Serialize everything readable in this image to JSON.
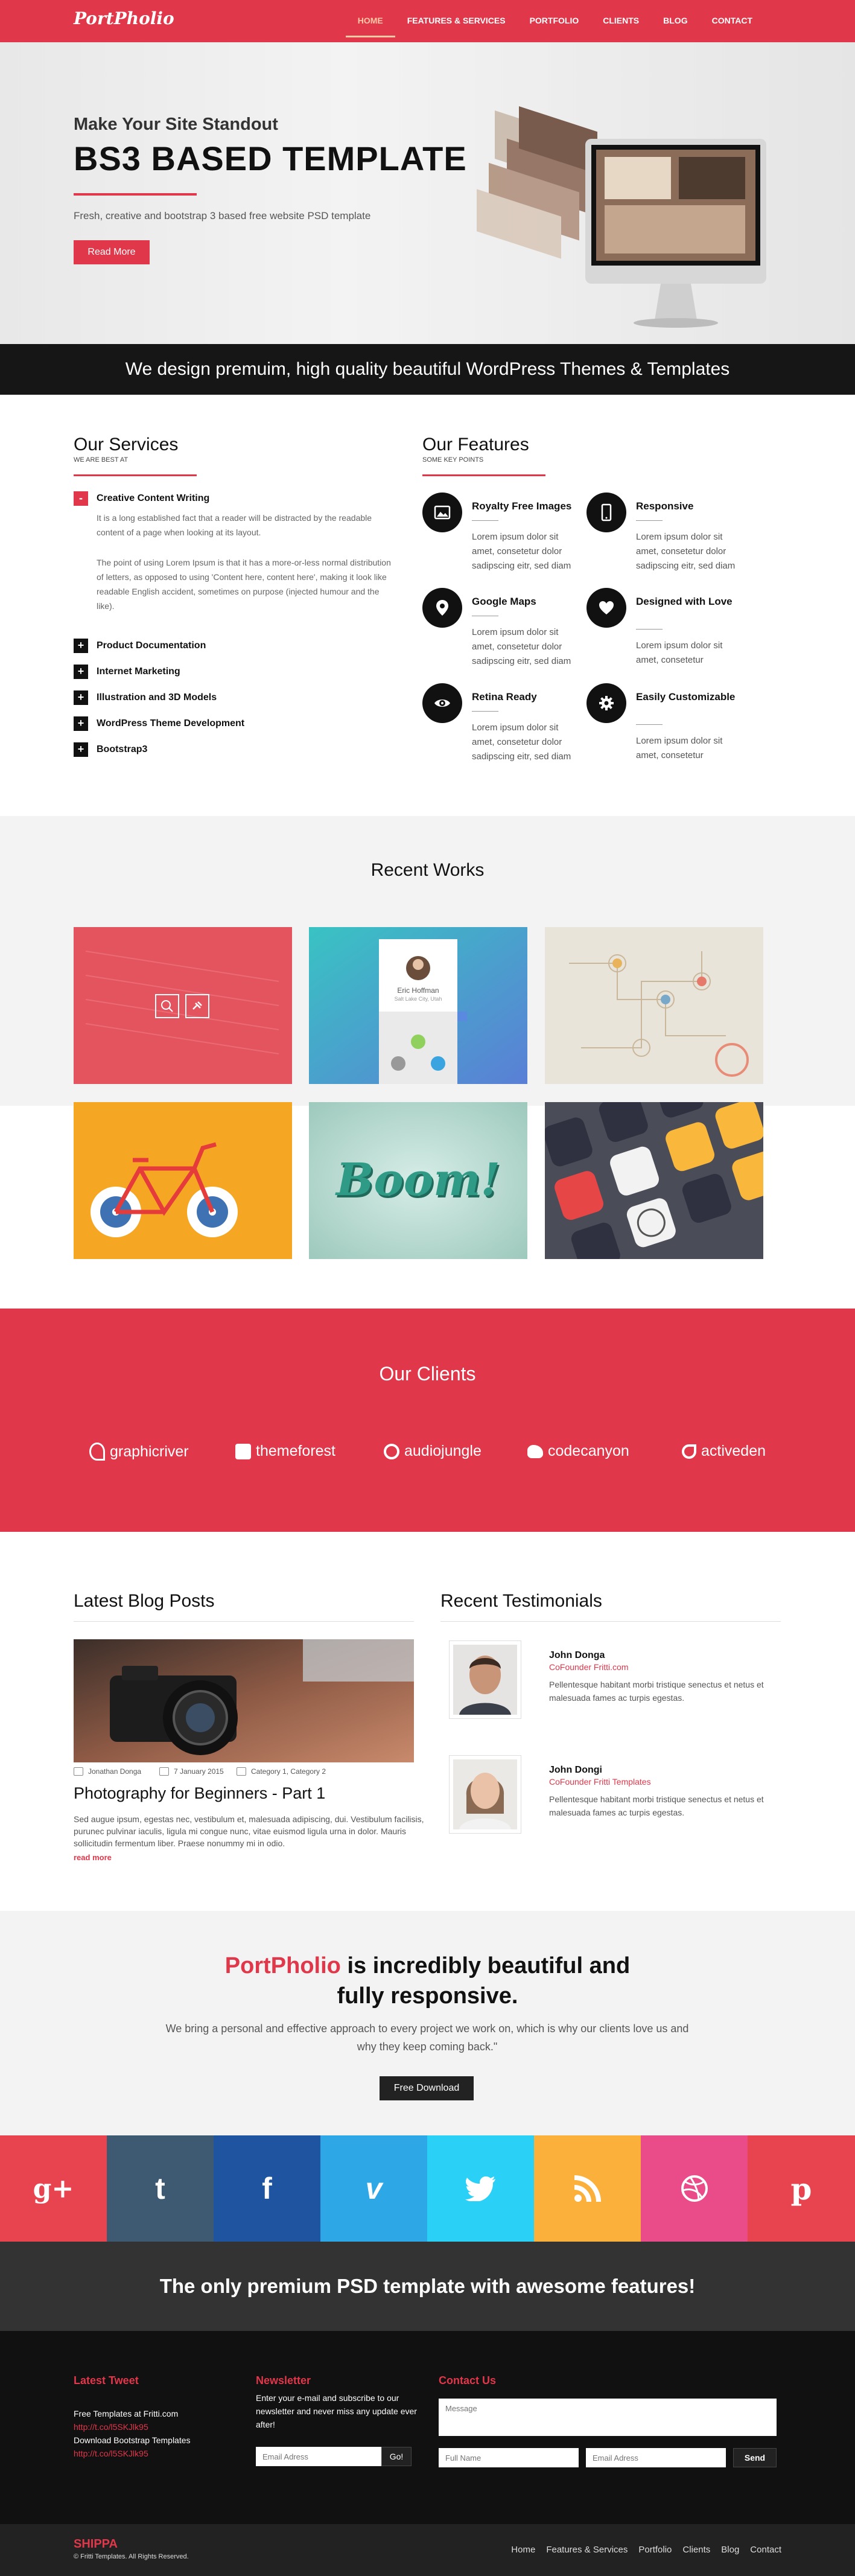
{
  "header": {
    "logo": "PortPholio",
    "nav": [
      "HOME",
      "FEATURES & SERVICES",
      "PORTFOLIO",
      "CLIENTS",
      "BLOG",
      "CONTACT"
    ]
  },
  "hero": {
    "subtitle": "Make Your Site Standout",
    "title": "BS3 BASED TEMPLATE",
    "description": "Fresh, creative and bootstrap 3 based free website PSD template",
    "button": "Read More"
  },
  "band": "We design premuim, high quality beautiful WordPress Themes & Templates",
  "services": {
    "title": "Our Services",
    "subtitle": "WE ARE BEST AT",
    "open_item": {
      "icon": "-",
      "title": "Creative Content Writing",
      "para1": "It is a long established fact that a reader will be distracted by the readable content of a page when looking at its layout.",
      "para2": "The point of using Lorem Ipsum is that it has a more-or-less normal distribution of letters, as opposed to using 'Content here, content here', making it look like readable English accident, sometimes on purpose (injected humour and the like)."
    },
    "items": [
      "Product Documentation",
      "Internet Marketing",
      "Illustration and 3D Models",
      "WordPress Theme Development",
      "Bootstrap3"
    ],
    "closed_icon": "+"
  },
  "features": {
    "title": "Our Features",
    "subtitle": "SOME KEY POINTS",
    "items": [
      {
        "title": "Royalty Free Images",
        "text": "Lorem ipsum dolor sit amet, consetetur dolor sadipscing eitr, sed diam",
        "icon": "image-icon"
      },
      {
        "title": "Responsive",
        "text": "Lorem ipsum dolor sit amet, consetetur dolor sadipscing eitr, sed diam",
        "icon": "phone-icon"
      },
      {
        "title": "Google Maps",
        "text": "Lorem ipsum dolor sit amet, consetetur dolor sadipscing eitr, sed diam",
        "icon": "map-pin-icon"
      },
      {
        "title": "Designed with Love",
        "text": "Lorem ipsum dolor sit amet, consetetur",
        "icon": "heart-icon"
      },
      {
        "title": "Retina Ready",
        "text": "Lorem ipsum dolor sit amet, consetetur dolor sadipscing eitr, sed diam",
        "icon": "eye-icon"
      },
      {
        "title": "Easily Customizable",
        "text": "Lorem ipsum dolor sit amet, consetetur",
        "icon": "gear-icon"
      }
    ]
  },
  "works": {
    "title": "Recent Works",
    "profile_name": "Eric Hoffman",
    "profile_location": "Salt Lake City, Utah",
    "boom": "Boom!"
  },
  "clients": {
    "title": "Our Clients",
    "items": [
      "graphicriver",
      "themeforest",
      "audiojungle",
      "codecanyon",
      "activeden"
    ]
  },
  "blog": {
    "title": "Latest Blog Posts",
    "author": "Jonathan Donga",
    "date": "7 January 2015",
    "category": "Category 1, Category 2",
    "post_title": "Photography for Beginners - Part 1",
    "excerpt": "Sed augue ipsum, egestas nec, vestibulum et, malesuada adipiscing, dui. Vestibulum facilisis, purunec pulvinar iaculis, ligula mi congue nunc, vitae euismod ligula urna in dolor. Mauris sollicitudin fermentum liber. Praese nonummy mi in odio.",
    "more": "read more"
  },
  "testimonials": {
    "title": "Recent Testimonials",
    "items": [
      {
        "name": "John Donga",
        "role": "CoFounder Fritti.com",
        "text": "Pellentesque habitant morbi tristique senectus et netus et malesuada fames ac turpis egestas."
      },
      {
        "name": "John Dongi",
        "role": "CoFounder Fritti Templates",
        "text": "Pellentesque habitant morbi tristique senectus et netus et malesuada fames ac turpis egestas."
      }
    ]
  },
  "cta": {
    "brand": "PortPholio",
    "heading_rest": " is incredibly beautiful and",
    "heading_line2": "fully responsive.",
    "text": "We bring a personal and effective approach to every project we work on, which is why our clients love us and why they keep coming back.\"",
    "button": "Free Download"
  },
  "social": [
    {
      "name": "google-plus",
      "glyph": "g+",
      "color": "#e84450"
    },
    {
      "name": "tumblr",
      "glyph": "t",
      "color": "#3e5a73"
    },
    {
      "name": "facebook",
      "glyph": "f",
      "color": "#1e54a0"
    },
    {
      "name": "vimeo",
      "glyph": "v",
      "color": "#2da7e6"
    },
    {
      "name": "twitter",
      "glyph": "twitter",
      "color": "#2ad0f5"
    },
    {
      "name": "rss",
      "glyph": "rss",
      "color": "#fbb03b"
    },
    {
      "name": "dribbble",
      "glyph": "dribbble",
      "color": "#ea4c89"
    },
    {
      "name": "pinterest",
      "glyph": "p",
      "color": "#e84450"
    }
  ],
  "premium": "The only premium PSD template with awesome features!",
  "footer": {
    "tweet_title": "Latest Tweet",
    "tweet1": "Free Templates at Fritti.com",
    "tweet1_link": "http://t.co/l5SKJlk95",
    "tweet2": "Download Bootstrap Templates",
    "tweet2_link": "http://t.co/l5SKJlk95",
    "newsletter_title": "Newsletter",
    "newsletter_text": "Enter your e-mail and subscribe to our newsletter and never miss any update ever after!",
    "email_placeholder": "Email Adress",
    "go": "Go!",
    "contact_title": "Contact Us",
    "message_placeholder": "Message",
    "fullname_placeholder": "Full Name",
    "email2_placeholder": "Email Adress",
    "send": "Send"
  },
  "bottom": {
    "logo": "SHIPPA",
    "copyright": "© Fritti Templates. All Rights Reserved.",
    "nav": [
      "Home",
      "Features & Services",
      "Portfolio",
      "Clients",
      "Blog",
      "Contact"
    ]
  },
  "colors": {
    "accent": "#e0374a",
    "dark": "#161616"
  }
}
